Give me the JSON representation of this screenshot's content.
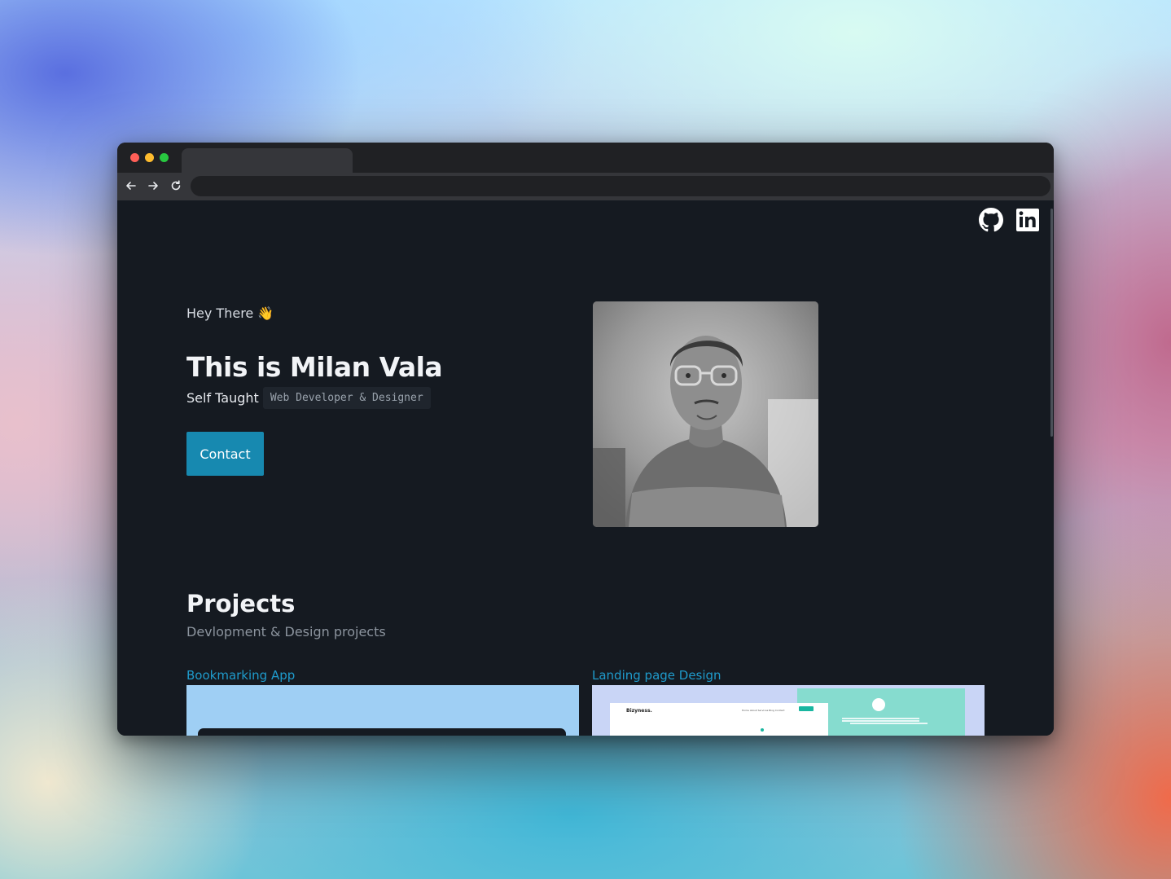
{
  "browser": {
    "controls": [
      "close",
      "minimize",
      "maximize"
    ],
    "nav_icons": [
      "back-arrow-icon",
      "forward-arrow-icon",
      "reload-icon"
    ]
  },
  "social": [
    {
      "name": "github-icon"
    },
    {
      "name": "linkedin-icon"
    }
  ],
  "hero": {
    "greeting": "Hey There 👋",
    "title": "This is Milan Vala",
    "tagline_prefix": "Self Taught",
    "tagline_code": "Web Developer & Designer",
    "contact_label": "Contact"
  },
  "projects": {
    "title": "Projects",
    "subtitle": "Devlopment & Design projects",
    "items": [
      {
        "label": "Bookmarking App"
      },
      {
        "label": "Landing page Design"
      }
    ]
  },
  "thumbnail2": {
    "logo": "Bizyness.",
    "menu": "Home   About   Services   Blog   Contact"
  },
  "colors": {
    "page_bg": "#151a21",
    "accent": "#1789b0",
    "link": "#1f9bcc"
  }
}
